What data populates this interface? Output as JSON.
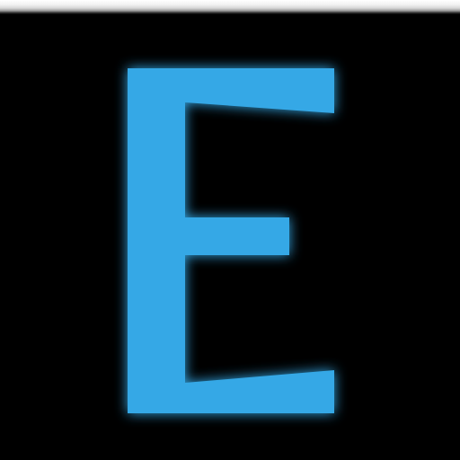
{
  "icon": {
    "name": "letter-e-icon",
    "letter": "E",
    "foreground_color": "#35A8E6",
    "background_color": "#000000"
  }
}
